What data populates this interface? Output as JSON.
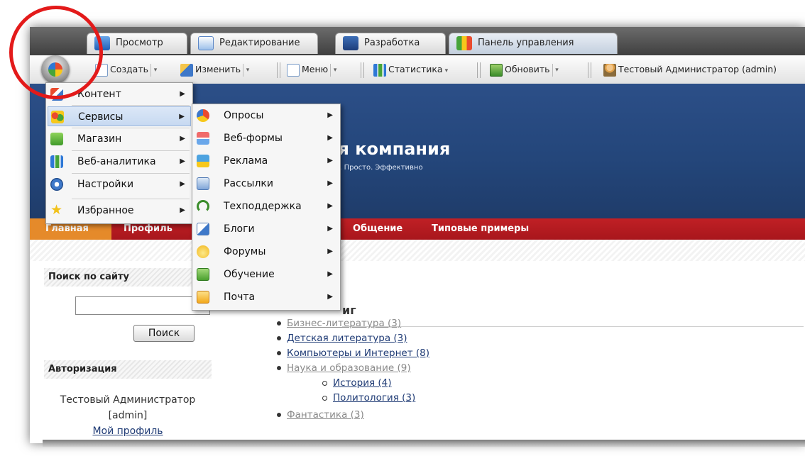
{
  "tabs": [
    {
      "label": "Просмотр",
      "icon": "monitor-icon"
    },
    {
      "label": "Редактирование",
      "icon": "pencil-icon"
    },
    {
      "label": "Разработка",
      "icon": "dev-icon"
    },
    {
      "label": "Панель управления",
      "icon": "control-panel-icon"
    }
  ],
  "toolbar": {
    "create": "Создать",
    "edit": "Изменить",
    "menu": "Меню",
    "stats": "Статистика",
    "refresh": "Обновить",
    "user": "Тестовый Администратор (admin)"
  },
  "site": {
    "title": "оя компания",
    "slogan": "тро. Просто. Эффективно"
  },
  "nav": {
    "home": "Главная",
    "profile": "Профиль",
    "community": "Общение",
    "examples": "Типовые примеры"
  },
  "sidebar": {
    "search_title": "Поиск по сайту",
    "search_button": "Поиск",
    "auth_title": "Авторизация",
    "user_name": "Тестовый Администратор",
    "user_login": "[admin]",
    "profile_link": "Мой профиль"
  },
  "catalog": {
    "heading": "иг",
    "items": [
      {
        "label": "Бизнес-литература (3)",
        "level": 1,
        "muted": true
      },
      {
        "label": "Детская литература (3)",
        "level": 1,
        "muted": false
      },
      {
        "label": "Компьютеры и Интернет (8)",
        "level": 1,
        "muted": false
      },
      {
        "label": "Наука и образование (9)",
        "level": 1,
        "muted": true
      },
      {
        "label": "История (4)",
        "level": 2,
        "muted": false
      },
      {
        "label": "Политология (3)",
        "level": 2,
        "muted": false
      },
      {
        "label": "Фантастика (3)",
        "level": 1,
        "muted": true
      }
    ]
  },
  "main_menu": [
    {
      "label": "Контент",
      "icon": "content-icon"
    },
    {
      "label": "Сервисы",
      "icon": "services-icon",
      "highlighted": true
    },
    {
      "label": "Магазин",
      "icon": "cart-icon"
    },
    {
      "label": "Веб-аналитика",
      "icon": "analytics-icon"
    },
    {
      "label": "Настройки",
      "icon": "settings-icon"
    },
    {
      "label": "Избранное",
      "icon": "star-icon"
    }
  ],
  "services_menu": [
    {
      "label": "Опросы",
      "icon": "poll-icon"
    },
    {
      "label": "Веб-формы",
      "icon": "webform-icon"
    },
    {
      "label": "Реклама",
      "icon": "ads-icon"
    },
    {
      "label": "Рассылки",
      "icon": "mailing-icon"
    },
    {
      "label": "Техподдержка",
      "icon": "support-icon"
    },
    {
      "label": "Блоги",
      "icon": "blog-icon"
    },
    {
      "label": "Форумы",
      "icon": "forum-icon"
    },
    {
      "label": "Обучение",
      "icon": "learning-icon"
    },
    {
      "label": "Почта",
      "icon": "mail-icon"
    }
  ],
  "colors": {
    "header_blue": "#234579",
    "nav_red": "#b71b21",
    "nav_active_orange": "#e58a2a",
    "highlight_circle": "#e31a1a",
    "link": "#1f3b75"
  }
}
